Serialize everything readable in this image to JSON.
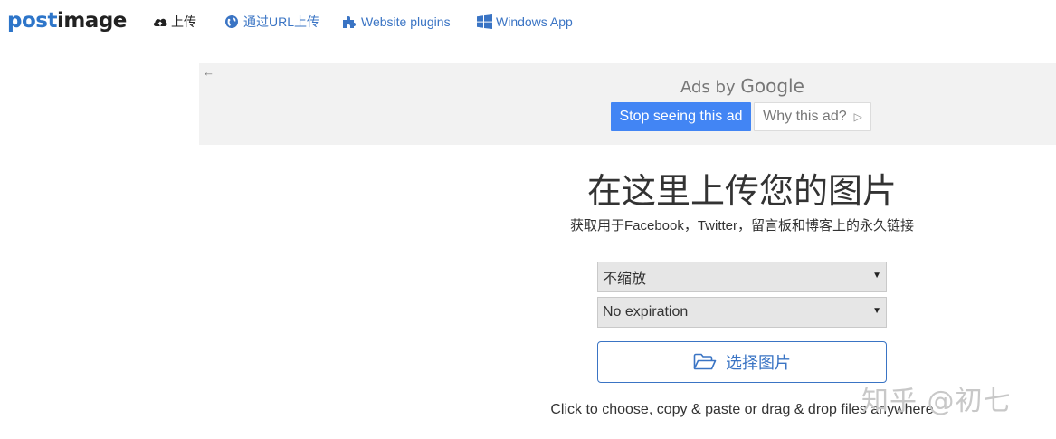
{
  "header": {
    "logo_part1": "post",
    "logo_part2": "image",
    "nav": {
      "upload": "上传",
      "url_upload": "通过URL上传",
      "plugins": "Website plugins",
      "windows": "Windows App"
    }
  },
  "ad": {
    "back": "←",
    "ads_by": "Ads by",
    "google": "Google",
    "stop_label": "Stop seeing this ad",
    "why_label": "Why this ad?",
    "why_icon": "▷"
  },
  "main": {
    "title": "在这里上传您的图片",
    "subtitle": "获取用于Facebook，Twitter，留言板和博客上的永久链接",
    "resize_select": "不缩放",
    "expiration_select": "No expiration",
    "choose_label": "选择图片",
    "hint": "Click to choose, copy & paste or drag & drop files anywhere"
  },
  "watermark": "知乎 @初七",
  "colors": {
    "brand_blue": "#3a74c4",
    "google_blue": "#4285f4",
    "ad_bg": "#f2f2f2",
    "select_bg": "#e6e6e6"
  },
  "icons": {
    "upload": "cloud-upload-icon",
    "url": "globe-icon",
    "plugins": "puzzle-icon",
    "windows": "windows-icon",
    "choose": "folder-open-icon",
    "select_arrow": "caret-down-icon"
  }
}
